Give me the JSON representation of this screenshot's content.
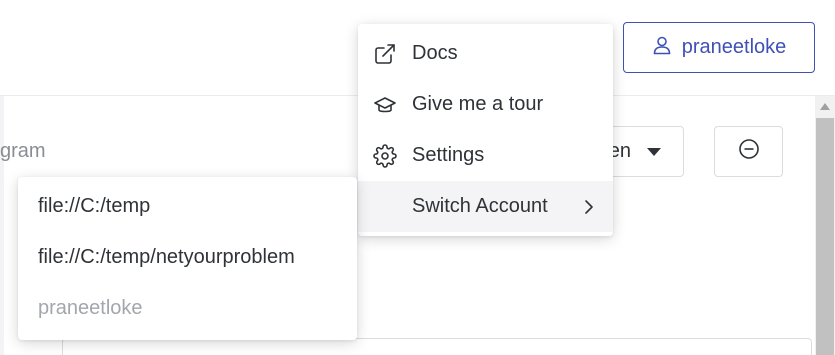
{
  "background": {
    "program_text": "gram",
    "branch_select_text": "en"
  },
  "user_button": {
    "label": "praneetloke",
    "icon": "user-icon",
    "color": "#3f51b5"
  },
  "main_menu": {
    "items": [
      {
        "label": "Docs",
        "icon": "external-link-icon"
      },
      {
        "label": "Give me a tour",
        "icon": "graduation-cap-icon"
      },
      {
        "label": "Settings",
        "icon": "gear-icon"
      },
      {
        "label": "Switch Account",
        "icon": "chevron-right-icon"
      }
    ]
  },
  "account_menu": {
    "items": [
      {
        "label": "file://C:/temp",
        "enabled": true
      },
      {
        "label": "file://C:/temp/netyourproblem",
        "enabled": true
      },
      {
        "label": "praneetloke",
        "enabled": false
      }
    ]
  }
}
